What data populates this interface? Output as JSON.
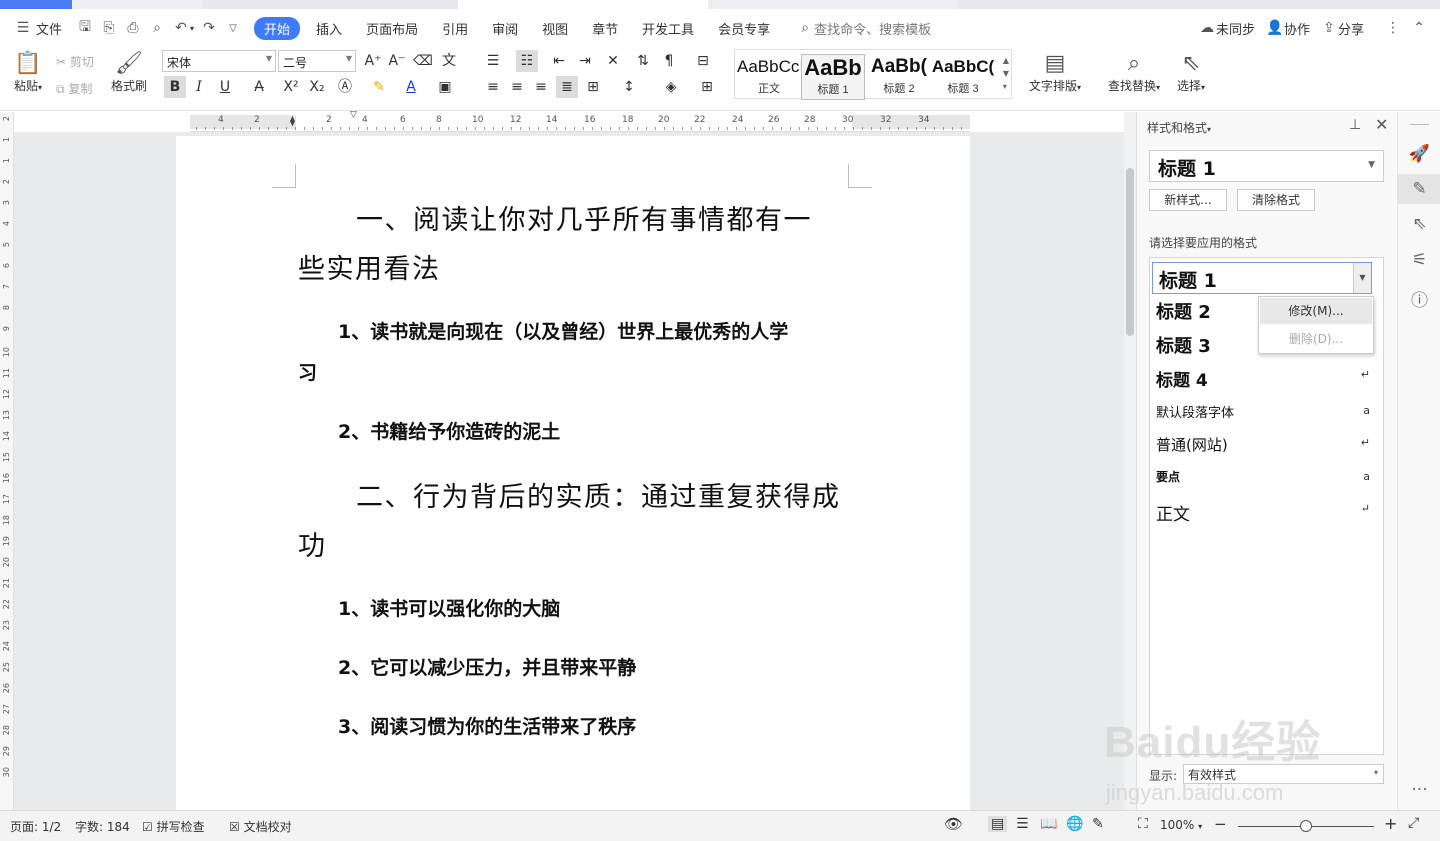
{
  "menubar": {
    "file": "文件",
    "tabs": [
      "开始",
      "插入",
      "页面布局",
      "引用",
      "审阅",
      "视图",
      "章节",
      "开发工具",
      "会员专享"
    ],
    "active_tab": "开始",
    "search_placeholder": "查找命令、搜索模板",
    "sync": "未同步",
    "collab": "协作",
    "share": "分享"
  },
  "ribbon": {
    "paste": "粘贴",
    "cut": "剪切",
    "copy": "复制",
    "format_painter": "格式刷",
    "font_name": "宋体",
    "font_size": "二号",
    "bold": "B",
    "italic": "I",
    "underline": "U",
    "font_color": "A",
    "styles": [
      {
        "preview": "AaBbCcI",
        "label": "正文"
      },
      {
        "preview": "AaBb",
        "label": "标题 1"
      },
      {
        "preview": "AaBb(",
        "label": "标题 2"
      },
      {
        "preview": "AaBbC(",
        "label": "标题 3"
      }
    ],
    "text_layout": "文字排版",
    "find_replace": "查找替换",
    "select": "选择"
  },
  "ruler": {
    "marks": [
      "4",
      "2",
      "2",
      "4",
      "6",
      "8",
      "10",
      "12",
      "14",
      "16",
      "18",
      "20",
      "22",
      "24",
      "26",
      "28",
      "30",
      "32",
      "34"
    ],
    "vmarks": [
      "2",
      "1",
      "1",
      "2",
      "3",
      "4",
      "5",
      "6",
      "7",
      "8",
      "9",
      "10",
      "11",
      "12",
      "13",
      "14",
      "15",
      "16",
      "17",
      "18",
      "19",
      "20",
      "21",
      "22",
      "23",
      "24",
      "25",
      "26",
      "27",
      "28",
      "29",
      "30"
    ]
  },
  "document": {
    "lines": [
      {
        "type": "h1",
        "text": "一、阅读让你对几乎所有事情都有一"
      },
      {
        "type": "h1cont",
        "text": "些实用看法"
      },
      {
        "type": "h2",
        "text": "1、读书就是向现在（以及曾经）世界上最优秀的人学"
      },
      {
        "type": "h2cont",
        "text": "习"
      },
      {
        "type": "h2",
        "text": "2、书籍给予你造砖的泥土"
      },
      {
        "type": "h1",
        "text": "二、行为背后的实质：通过重复获得成"
      },
      {
        "type": "h1cont",
        "text": "功"
      },
      {
        "type": "h2",
        "text": "1、读书可以强化你的大脑"
      },
      {
        "type": "h2",
        "text": "2、它可以减少压力，并且带来平静"
      },
      {
        "type": "h2",
        "text": "3、阅读习惯为你的生活带来了秩序"
      }
    ]
  },
  "panel": {
    "title": "样式和格式",
    "current_style": "标题  1",
    "new_style": "新样式...",
    "clear_format": "清除格式",
    "choose_label": "请选择要应用的格式",
    "selected": "标题  1",
    "items": [
      {
        "text": "标题  2",
        "mark": ""
      },
      {
        "text": "标题  3",
        "mark": ""
      },
      {
        "text": "标题  4",
        "mark": "↵"
      },
      {
        "text": "默认段落字体",
        "mark": "a"
      },
      {
        "text": "普通(网站)",
        "mark": "↵"
      },
      {
        "text": "要点",
        "mark": "a"
      },
      {
        "text": "正文",
        "mark": "↵"
      }
    ],
    "context_menu": {
      "modify": "修改(M)...",
      "delete": "删除(D)..."
    },
    "show_label": "显示:",
    "show_value": "有效样式"
  },
  "status": {
    "page": "页面: 1/2",
    "words": "字数: 184",
    "spell": "拼写检查",
    "proof": "文档校对",
    "zoom": "100%"
  },
  "watermark": {
    "brand": "Baidu经验",
    "url": "jingyan.baidu.com"
  }
}
